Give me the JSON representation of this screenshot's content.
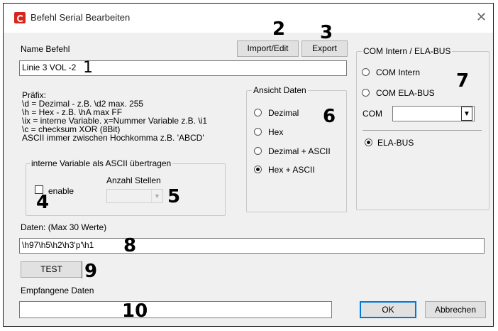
{
  "window": {
    "title": "Befehl Serial Bearbeiten"
  },
  "name": {
    "label": "Name Befehl",
    "value": "Linie 3 VOL -2"
  },
  "buttons": {
    "import_edit": "Import/Edit",
    "export": "Export",
    "test": "TEST",
    "ok": "OK",
    "cancel": "Abbrechen"
  },
  "info": {
    "lines": [
      "Präfix:",
      "\\d = Dezimal - z.B. \\d2 max. 255",
      "\\h = Hex -  z.B. \\hA max FF",
      "\\ix = interne Variable. x=Nummer Variable z.B. \\i1",
      "\\c = checksum XOR (8Bit)",
      "ASCII immer zwischen Hochkomma z.B. 'ABCD'"
    ]
  },
  "intern_var": {
    "group_label": "interne Variable als ASCII übertragen",
    "enable_label": "enable",
    "digits_label": "Anzahl Stellen"
  },
  "view": {
    "group_label": "Ansicht Daten",
    "options": [
      "Dezimal",
      "Hex",
      "Dezimal + ASCII",
      "Hex + ASCII"
    ],
    "selected": "Hex + ASCII"
  },
  "com": {
    "group_label": "COM Intern / ELA-BUS",
    "options": [
      "COM Intern",
      "COM ELA-BUS"
    ],
    "com_label": "COM",
    "ela_label": "ELA-BUS",
    "selected": "ELA-BUS"
  },
  "data_field": {
    "label": "Daten: (Max 30 Werte)",
    "value": "\\h97\\h5\\h2\\h3'p'\\h1"
  },
  "received": {
    "label": "Empfangene Daten",
    "value": ""
  },
  "annotations": [
    "1",
    "2",
    "3",
    "4",
    "5",
    "6",
    "7",
    "8",
    "9",
    "10"
  ]
}
